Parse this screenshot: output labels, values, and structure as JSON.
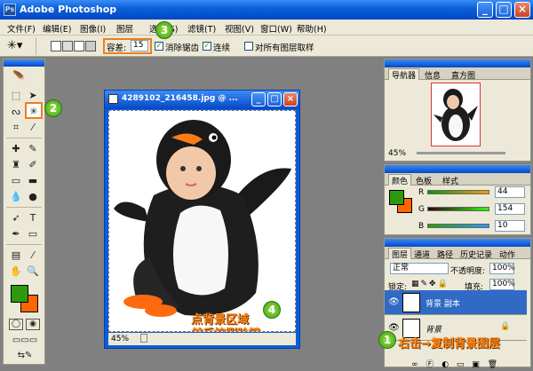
{
  "app": {
    "title": "Adobe Photoshop",
    "icon": "ps-icon"
  },
  "window_buttons": [
    "_",
    "□",
    "×"
  ],
  "menu": [
    "文件(F)",
    "编辑(E)",
    "图像(I)",
    "图层",
    "选择(S)",
    "滤镜(T)",
    "视图(V)",
    "窗口(W)",
    "帮助(H)"
  ],
  "options": {
    "tolerance_label": "容差:",
    "tolerance_value": "15",
    "antialias_label": "消除锯齿",
    "contiguous_label": "连续",
    "all_layers_label": "对所有图层取样"
  },
  "document": {
    "title": "4289102_216458.jpg @ ...",
    "zoom": "45%"
  },
  "navigator": {
    "tabs": [
      "导航器",
      "信息",
      "直方图"
    ],
    "zoom": "45%"
  },
  "color_panel": {
    "tabs": [
      "颜色",
      "色板",
      "样式"
    ],
    "channels": [
      {
        "label": "R",
        "value": "44"
      },
      {
        "label": "G",
        "value": "154"
      },
      {
        "label": "B",
        "value": "10"
      }
    ],
    "foreground": "#2c9a0a",
    "background": "#ff6600"
  },
  "layers_panel": {
    "tabs": [
      "图层",
      "通道",
      "路径",
      "历史记录",
      "动作"
    ],
    "blend_mode": "正常",
    "opacity_label": "不透明度:",
    "opacity_value": "100%",
    "lock_label": "锁定:",
    "fill_label": "填充:",
    "fill_value": "100%",
    "layers": [
      {
        "name": "背景 副本",
        "selected": true
      },
      {
        "name": "背景",
        "selected": false
      }
    ]
  },
  "annotations": {
    "step1": "1",
    "step2": "2",
    "step3": "3",
    "step4": "4",
    "note_right_click": "右击→复制背景图层",
    "note_canvas_line1": "点背景区域",
    "note_canvas_line2": "然后按删除键"
  }
}
